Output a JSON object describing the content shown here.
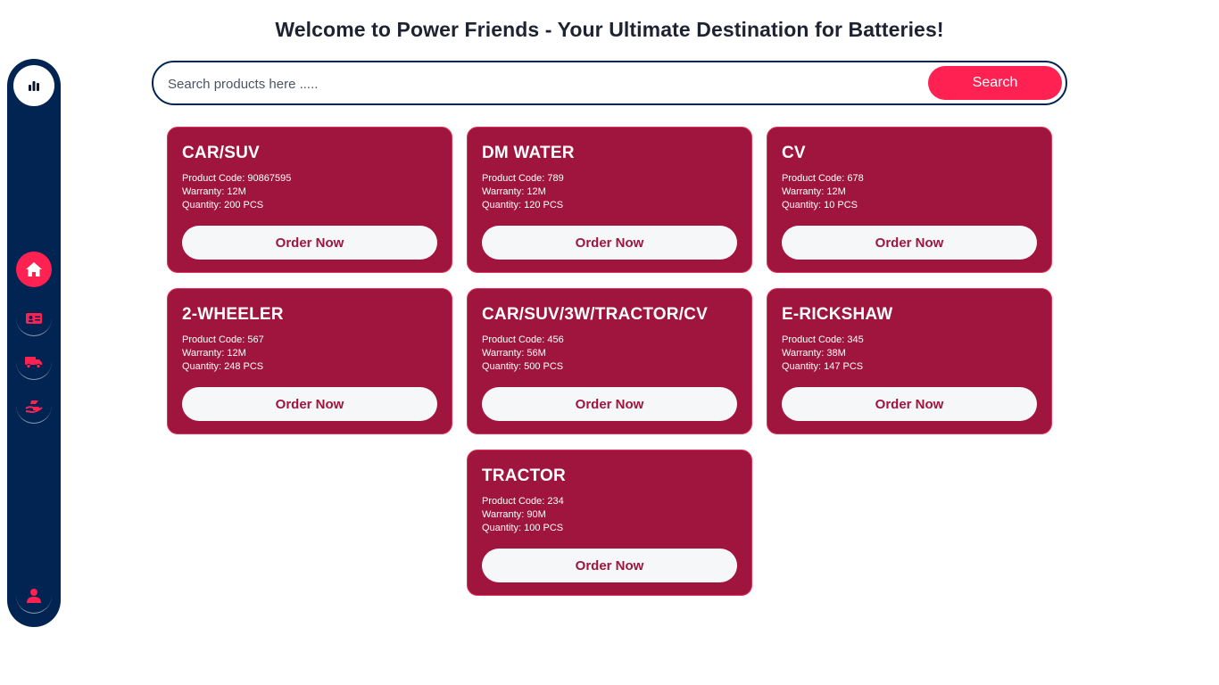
{
  "header": {
    "title": "Welcome to Power Friends - Your Ultimate Destination for Batteries!"
  },
  "search": {
    "placeholder": "Search products here .....",
    "value": "",
    "button_label": "Search"
  },
  "sidebar": {
    "items": [
      {
        "icon": "dashboard-chart-icon",
        "active": false
      },
      {
        "icon": "home-icon",
        "active": true
      },
      {
        "icon": "id-card-icon",
        "active": false
      },
      {
        "icon": "delivery-truck-icon",
        "active": false
      },
      {
        "icon": "hand-holding-icon",
        "active": false
      },
      {
        "icon": "user-icon",
        "active": false
      }
    ]
  },
  "labels": {
    "product_code": "Product Code:",
    "warranty": "Warranty:",
    "quantity": "Quantity:",
    "order_now": "Order Now"
  },
  "products": [
    {
      "name": "CAR/SUV",
      "code": "90867595",
      "warranty": "12M",
      "quantity": "200 PCS"
    },
    {
      "name": "DM WATER",
      "code": "789",
      "warranty": "12M",
      "quantity": "120 PCS"
    },
    {
      "name": "CV",
      "code": "678",
      "warranty": "12M",
      "quantity": "10 PCS"
    },
    {
      "name": "2-WHEELER",
      "code": "567",
      "warranty": "12M",
      "quantity": "248 PCS"
    },
    {
      "name": "CAR/SUV/3W/TRACTOR/CV",
      "code": "456",
      "warranty": "56M",
      "quantity": "500 PCS"
    },
    {
      "name": "E-RICKSHAW",
      "code": "345",
      "warranty": "38M",
      "quantity": "147 PCS"
    },
    {
      "name": "TRACTOR",
      "code": "234",
      "warranty": "90M",
      "quantity": "100 PCS"
    }
  ],
  "colors": {
    "sidebar_bg": "#022452",
    "accent": "#fe2151",
    "card_bg": "#9f153e",
    "button_bg": "#f6f7f9"
  }
}
